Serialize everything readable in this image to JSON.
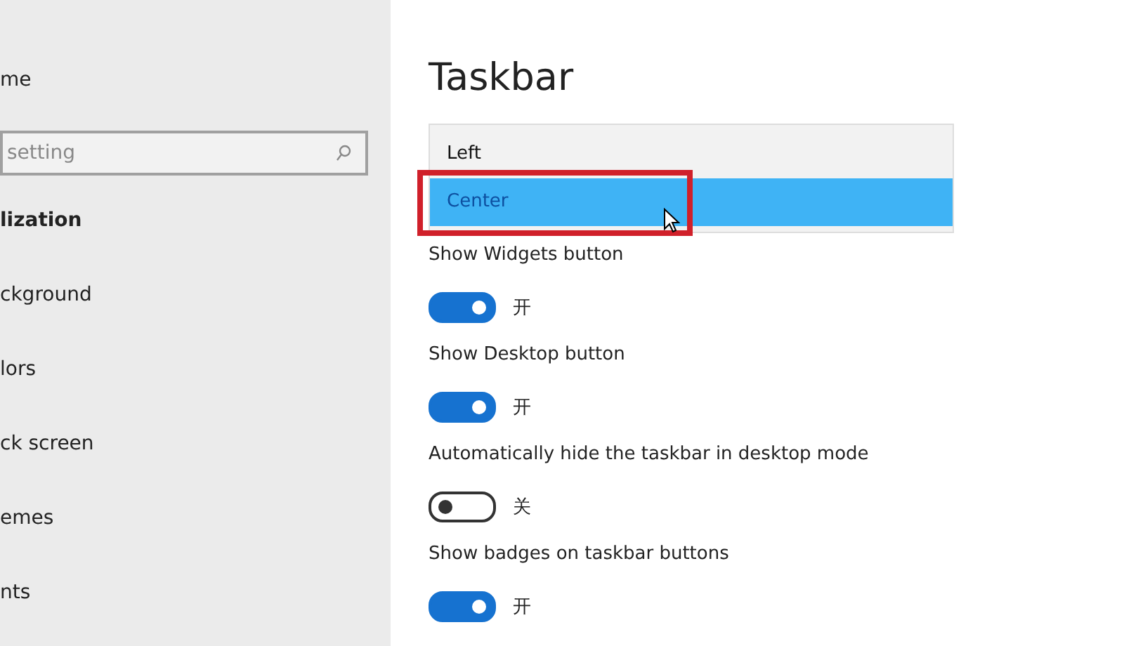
{
  "sidebar": {
    "home": "me",
    "search": {
      "placeholder": "setting"
    },
    "section": "lization",
    "items": [
      {
        "label": "ckground"
      },
      {
        "label": "lors"
      },
      {
        "label": "ck screen"
      },
      {
        "label": "emes"
      },
      {
        "label": "nts"
      }
    ]
  },
  "main": {
    "title": "Taskbar",
    "dropdown": {
      "options": [
        {
          "label": "Left",
          "selected": false,
          "highlighted": false
        },
        {
          "label": "Center",
          "selected": true,
          "highlighted": true
        }
      ]
    },
    "settings": [
      {
        "label": "Show Widgets button",
        "on": true,
        "state": "开"
      },
      {
        "label": "Show Desktop button",
        "on": true,
        "state": "开"
      },
      {
        "label": "Automatically hide the taskbar in desktop mode",
        "on": false,
        "state": "关"
      },
      {
        "label": "Show badges on taskbar buttons",
        "on": true,
        "state": "开"
      }
    ]
  }
}
